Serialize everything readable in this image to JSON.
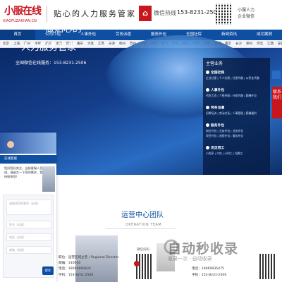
{
  "header": {
    "logo_text": "小服在线",
    "logo_sub": "XIAOFUZAIXIAN.CN",
    "slogan": "贴心的人力服务管家",
    "hotline_label": "微信热线",
    "hotline_number": "153-8231-2506",
    "wechat_lines": [
      "小服人力",
      "企业微信"
    ]
  },
  "nav": {
    "items": [
      "首页",
      "公司介绍",
      "人事外包",
      "劳务派遣",
      "服务外包",
      "全国社保",
      "新闻资讯",
      "成功案例"
    ]
  },
  "cities": [
    "北京",
    "上海",
    "广州",
    "深圳",
    "武汉",
    "沈阳",
    "四川",
    "重庆",
    "大连",
    "江苏",
    "天津",
    "杭州",
    "苏州",
    "宁波",
    "福建",
    "厦门",
    "青岛",
    "西安",
    "济南",
    "合肥",
    "成都",
    "南京",
    "长沙",
    "郑州",
    "河北",
    "江西",
    "安徽",
    "陕西",
    "南昌",
    "长春",
    "海南",
    "太原"
  ],
  "hero": {
    "line1": "做贴心的",
    "line2": "人力服务管家",
    "qq_line": "全国微信在线服务：153-8231-2506"
  },
  "panel": {
    "heading": "主营业务",
    "sections": [
      {
        "title": "全国社保",
        "items": [
          "企业社保 | 个人社保 | 社保代缴 | 公积金代缴"
        ]
      },
      {
        "title": "人事外包",
        "items": [
          "代招工资 | 个税申报 | 社保代缴 | 薪酬外包"
        ]
      },
      {
        "title": "劳务派遣",
        "items": [
          "招聘培训 | 劳动关系 | 人事管理 | 薪酬福利"
        ]
      },
      {
        "title": "服务外包",
        "items": [
          "岗位外包 | 业务外包 | 业务外包",
          "项目外包 | 流程外包 | 服务外包"
        ]
      },
      {
        "title": "灵活用工",
        "items": [
          "小程序 | 众包 | 小时工 | 短期工"
        ]
      }
    ]
  },
  "side_tab": "联系我们",
  "team": {
    "title": "运营中心团队",
    "subtitle": "OPERATION TEAM",
    "card1": {
      "lines": [
        "职位：运营区域主管 / Regional Director",
        "邮编：310000",
        "电话：18069869424",
        "手机：153-8231-2506"
      ],
      "qr_label": "微信扫码"
    },
    "card2": {
      "lines": [
        "电话：18069935475",
        "手机：153-8231-2506"
      ]
    }
  },
  "watermark": {
    "text": "自动秒收录",
    "sub": "收录一次 · 自动收录"
  },
  "chat": {
    "head": "在线客服",
    "bubble": "您好您好关注，当前客服人员不在线。请留言一下您的需求，我们会尽快联系您！",
    "fields": [
      "请描述您的需求（必填）",
      "姓名（必填）",
      "电话（必填）",
      "邮箱（选填）"
    ],
    "submit": "提交"
  }
}
